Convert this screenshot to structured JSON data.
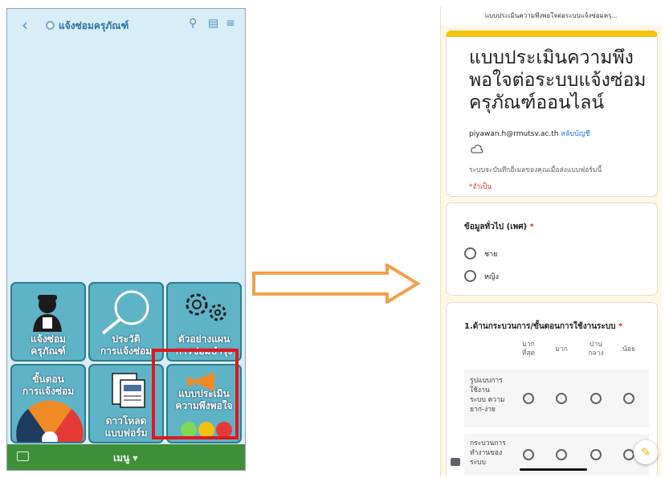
{
  "left_app": {
    "title": "แจ้งซ่อมครุภัณฑ์",
    "tiles": [
      {
        "label": "แจ้งซ่อม\nครุภัณฑ์"
      },
      {
        "label": "ประวัติ\nการแจ้งซ่อม"
      },
      {
        "label": "ตัวอย่างแผน\nการซ่อมบำรุง"
      },
      {
        "label": "ขั้นตอน\nการแจ้งซ่อม"
      },
      {
        "label": "ดาวโหลด\nแบบฟอร์ม"
      },
      {
        "label": "แบบประเมิน\nความพึงพอใจ"
      }
    ],
    "menu_label": "เมนู ▾"
  },
  "form": {
    "titlebar": "แบบประเมินความพึงพอใจต่อระบบแจ้งซ่อมครุ...",
    "title": "แบบประเมินความพึงพอใจต่อระบบแจ้งซ่อมครุภัณฑ์ออนไลน์",
    "email": "piyawan.h@rmutsv.ac.th",
    "switch_account": "สลับบัญชี",
    "note": "ระบบจะบันทึกอีเมลของคุณเมื่อส่งแบบฟอร์มนี้",
    "required": "*จำเป็น",
    "q1": {
      "title": "ข้อมูลทั่วไป (เพศ)",
      "star": "*",
      "options": [
        "ชาย",
        "หญิง"
      ]
    },
    "q2": {
      "title": "1.ด้านกระบวนการ/ขั้นตอนการใช้งานระบบ",
      "star": "*",
      "columns": [
        "มาก\nที่สุด",
        "มาก",
        "ปาน\nกลาง",
        "น้อย"
      ],
      "rows": [
        "รูปแบบการ\nใช้งาน\nระบบ ความ\nยาก-ง่าย",
        "กระบวนการ\nทำงานของ\nระบบ"
      ]
    }
  },
  "colors": {
    "tile": "#5fb3c7",
    "highlight": "#e0171f",
    "arrow": "#f0a04b",
    "form_accent": "#f4c20d",
    "bottombar": "#3f8f3a"
  }
}
